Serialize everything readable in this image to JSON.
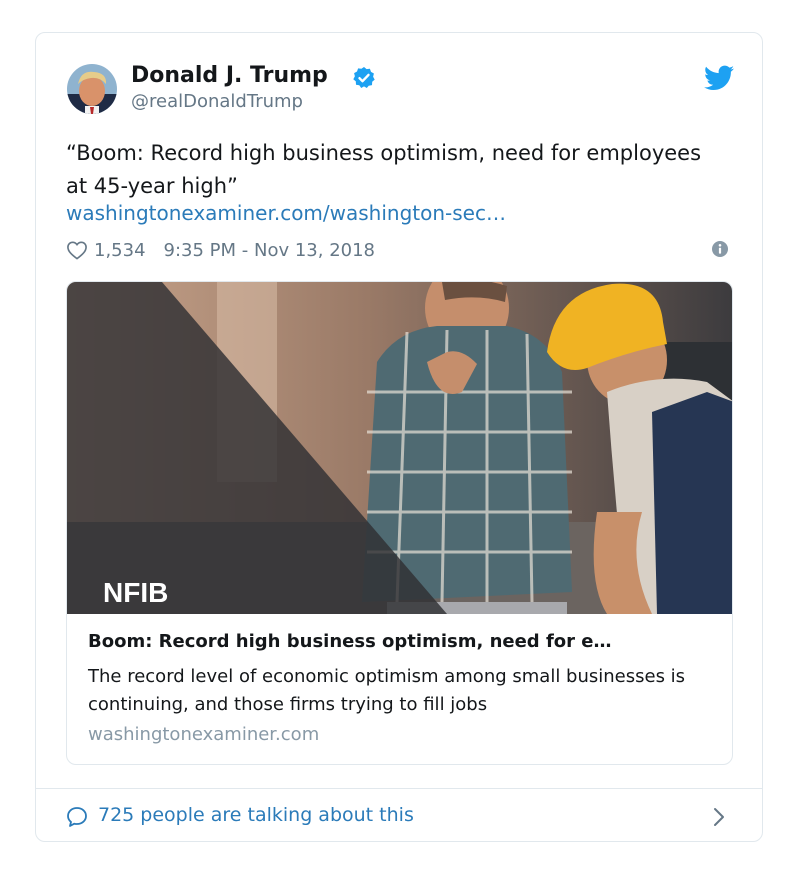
{
  "tweet": {
    "author_name": "Donald J. Trump",
    "handle": "@realDonaldTrump",
    "text": "“Boom: Record high business optimism, need for employees at 45-year high”",
    "link": "washingtonexaminer.com/washington-sec…",
    "likes": "1,534",
    "timestamp": "9:35 PM - Nov 13, 2018",
    "icons": {
      "verified": "verified-badge-icon",
      "brand": "twitter-bird-icon",
      "like": "heart-icon",
      "info": "info-icon"
    }
  },
  "preview": {
    "image_logo": "NFIB",
    "title": "Boom: Record high business optimism, need for e…",
    "description": "The record level of economic optimism among small businesses is continuing, and those firms trying to fill jobs",
    "domain": "washingtonexaminer.com"
  },
  "footer": {
    "label": "725 people are talking about this",
    "icons": {
      "comment": "speech-bubble-icon",
      "chevron": "chevron-right-icon"
    }
  },
  "colors": {
    "brand_blue": "#1da1f2",
    "link_blue": "#2b7bb9",
    "secondary_text": "#657786",
    "border": "#e1e8ed"
  }
}
